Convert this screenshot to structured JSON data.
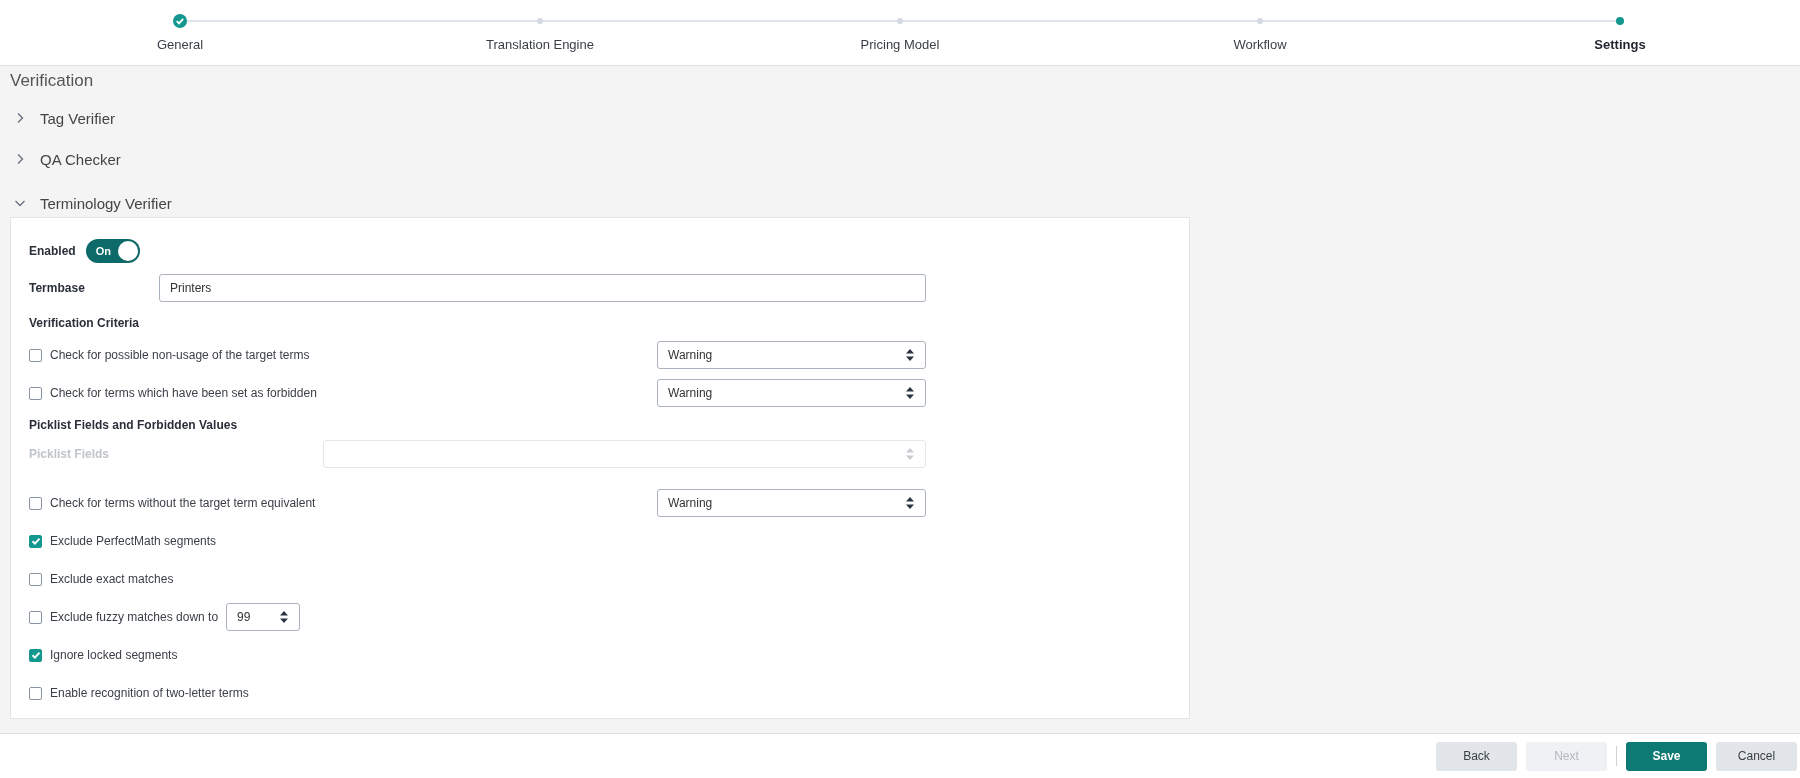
{
  "steps": [
    {
      "label": "General",
      "completed": true,
      "selected": false
    },
    {
      "label": "Translation Engine",
      "completed": false,
      "selected": false
    },
    {
      "label": "Pricing Model",
      "completed": false,
      "selected": false
    },
    {
      "label": "Workflow",
      "completed": false,
      "selected": false
    },
    {
      "label": "Settings",
      "completed": false,
      "selected": true
    }
  ],
  "section_title": "Verification",
  "accordions": [
    {
      "label": "Tag Verifier",
      "expanded": false
    },
    {
      "label": "QA Checker",
      "expanded": false
    },
    {
      "label": "Terminology Verifier",
      "expanded": true
    }
  ],
  "panel_rows": [
    {
      "kind": "toggle",
      "label": "Enabled",
      "on": true,
      "text": "On"
    },
    {
      "kind": "text_field",
      "label": "Termbase",
      "value": "Printers"
    },
    {
      "kind": "heading",
      "text": "Verification Criteria"
    },
    {
      "kind": "check_select",
      "label": "Check for possible non-usage of the target terms",
      "checked": false,
      "value": "Warning"
    },
    {
      "kind": "check_select",
      "label": "Check for terms which have been set as forbidden",
      "checked": false,
      "value": "Warning"
    },
    {
      "kind": "heading",
      "text": "Picklist Fields and Forbidden Values"
    },
    {
      "kind": "select_field",
      "label": "Picklist Fields",
      "disabled": true
    },
    {
      "kind": "check_select",
      "label": "Check for terms without the target term equivalent",
      "checked": false,
      "value": "Warning"
    },
    {
      "kind": "checkbox",
      "label": "Exclude PerfectMath segments",
      "checked": true
    },
    {
      "kind": "checkbox",
      "label": "Exclude exact matches",
      "checked": false
    },
    {
      "kind": "check_number",
      "label": "Exclude fuzzy matches down to",
      "checked": false,
      "value": "99"
    },
    {
      "kind": "checkbox",
      "label": "Ignore locked segments",
      "checked": true
    },
    {
      "kind": "checkbox",
      "label": "Enable recognition of two-letter terms",
      "checked": false
    }
  ],
  "footer_buttons": [
    {
      "label": "Back",
      "kind": "secondary",
      "disabled": false
    },
    {
      "label": "Next",
      "kind": "secondary",
      "disabled": true
    },
    {
      "label": "Save",
      "kind": "primary",
      "disabled": false
    },
    {
      "label": "Cancel",
      "kind": "secondary",
      "disabled": false
    }
  ]
}
